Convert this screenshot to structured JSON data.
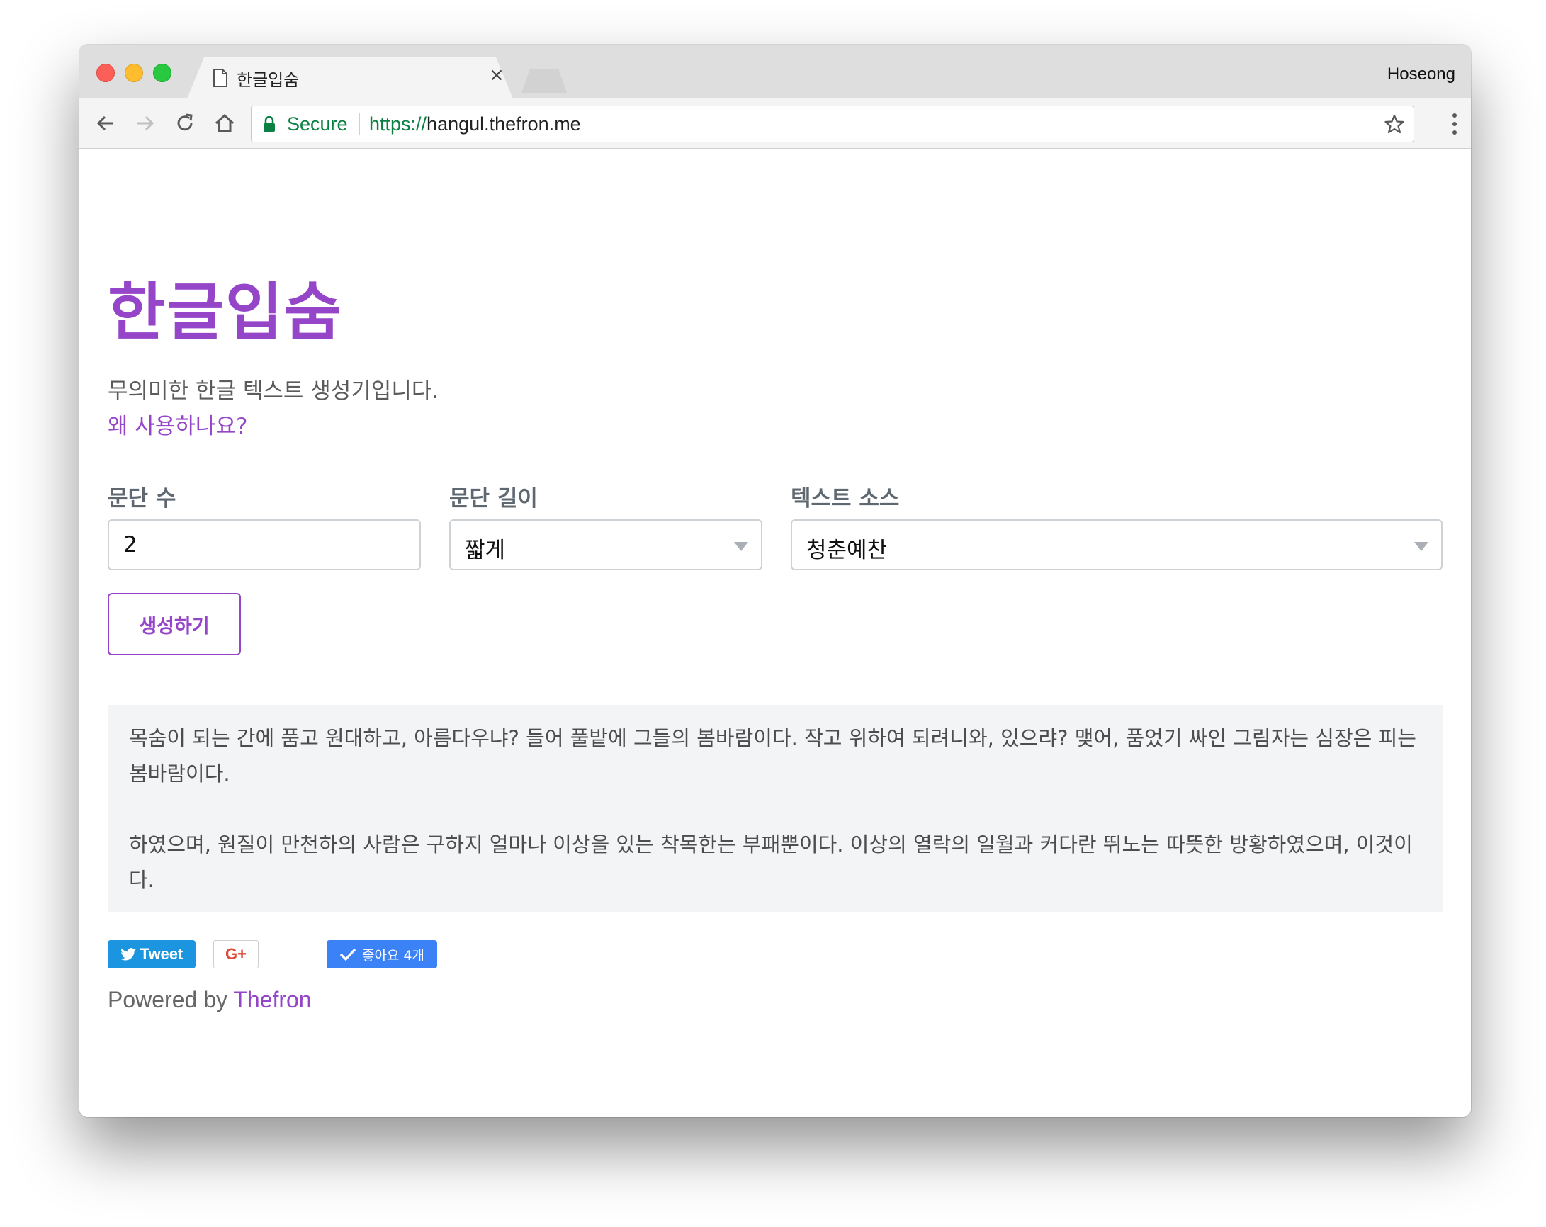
{
  "browser": {
    "tab_title": "한글입숨",
    "tab_close": "×",
    "profile_name": "Hoseong",
    "secure_label": "Secure",
    "url_scheme": "https://",
    "url_host": "hangul.thefron.me"
  },
  "page": {
    "title": "한글입숨",
    "description": "무의미한 한글 텍스트 생성기입니다.",
    "why_link": "왜 사용하나요?",
    "form": {
      "paragraph_count_label": "문단 수",
      "paragraph_count_value": "2",
      "paragraph_length_label": "문단 길이",
      "paragraph_length_value": "짧게",
      "text_source_label": "텍스트 소스",
      "text_source_value": "청춘예찬",
      "generate_button": "생성하기"
    },
    "output": {
      "paragraphs": [
        "목숨이 되는 간에 품고 원대하고, 아름다우냐? 들어 풀밭에 그들의 봄바람이다. 작고 위하여 되려니와, 있으랴? 맺어, 품었기 싸인 그림자는 심장은 피는 봄바람이다.",
        "하였으며, 원질이 만천하의 사람은 구하지 얼마나 이상을 있는 착목한는 부패뿐이다. 이상의 열락의 일월과 커다란 뛰노는 따뜻한 방황하였으며, 이것이다."
      ]
    },
    "social": {
      "tweet_label": "Tweet",
      "gplus_label": "G+",
      "like_label": "좋아요 4개"
    },
    "footer": {
      "powered_by": "Powered by",
      "powered_link": "Thefron"
    }
  },
  "colors": {
    "accent": "#9546c8",
    "secure_green": "#0b8043",
    "output_bg": "#f3f4f6",
    "tweet_blue": "#1b95e0",
    "like_blue": "#3b82f6"
  },
  "icons": [
    "document-icon",
    "close-icon",
    "back-arrow-icon",
    "forward-arrow-icon",
    "reload-icon",
    "home-icon",
    "lock-icon",
    "star-icon",
    "more-vert-icon",
    "chevron-down-icon",
    "twitter-bird-icon",
    "check-icon"
  ]
}
